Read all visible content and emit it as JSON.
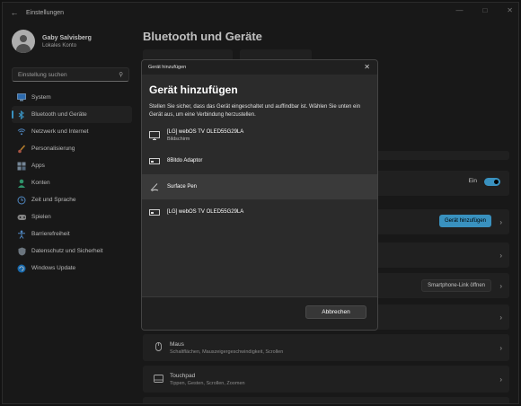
{
  "app": {
    "title": "Einstellungen"
  },
  "profile": {
    "name": "Gaby Salvisberg",
    "account": "Lokales Konto"
  },
  "search": {
    "placeholder": "Einstellung suchen"
  },
  "sidebar": {
    "items": [
      {
        "label": "System",
        "icon": "monitor-icon",
        "active": false
      },
      {
        "label": "Bluetooth und Geräte",
        "icon": "bluetooth-icon",
        "active": true
      },
      {
        "label": "Netzwerk und Internet",
        "icon": "wifi-icon",
        "active": false
      },
      {
        "label": "Personalisierung",
        "icon": "brush-icon",
        "active": false
      },
      {
        "label": "Apps",
        "icon": "apps-icon",
        "active": false
      },
      {
        "label": "Konten",
        "icon": "person-icon",
        "active": false
      },
      {
        "label": "Zeit und Sprache",
        "icon": "globe-clock-icon",
        "active": false
      },
      {
        "label": "Spielen",
        "icon": "gamepad-icon",
        "active": false
      },
      {
        "label": "Barrierefreiheit",
        "icon": "accessibility-icon",
        "active": false
      },
      {
        "label": "Datenschutz und Sicherheit",
        "icon": "shield-icon",
        "active": false
      },
      {
        "label": "Windows Update",
        "icon": "update-icon",
        "active": false
      }
    ]
  },
  "main": {
    "title": "Bluetooth und Geräte",
    "bluetooth_state": "Ein",
    "add_device_button": "Gerät hinzufügen",
    "phone_link_button": "Smartphone-Link öffnen",
    "rows": [
      {
        "title": "Maus",
        "subtitle": "Schaltflächen, Mauszeigergeschwindigkeit, Scrollen"
      },
      {
        "title": "Touchpad",
        "subtitle": "Tippen, Gesten, Scrollen, Zoomen"
      }
    ]
  },
  "dialog": {
    "window_title": "Gerät hinzufügen",
    "heading": "Gerät hinzufügen",
    "instructions": "Stellen Sie sicher, dass das Gerät eingeschaltet und auffindbar ist. Wählen Sie unten ein Gerät aus, um eine Verbindung herzustellen.",
    "devices": [
      {
        "name": "[LG] webOS TV OLED55G29LA",
        "subtitle": "Bildschirm",
        "icon": "display-icon"
      },
      {
        "name": "8Bitdo Adaptor",
        "subtitle": "",
        "icon": "input-device-icon"
      },
      {
        "name": "Surface Pen",
        "subtitle": "",
        "icon": "pen-icon"
      },
      {
        "name": "[LG] webOS TV OLED55G29LA",
        "subtitle": "",
        "icon": "input-device-icon"
      }
    ],
    "cancel_button": "Abbrechen"
  },
  "colors": {
    "accent": "#4cc2ff",
    "background": "#202020",
    "card": "#2b2b2b"
  }
}
